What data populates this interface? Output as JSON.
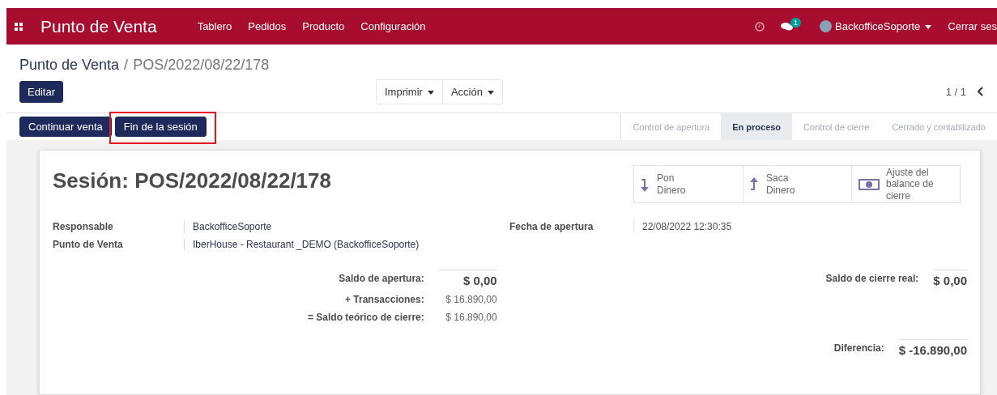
{
  "navbar": {
    "app_title": "Punto de Venta",
    "menu": [
      "Tablero",
      "Pedidos",
      "Producto",
      "Configuración"
    ],
    "messages_badge": "1",
    "user": "BackofficeSoporte",
    "logout": "Cerrar ses"
  },
  "breadcrumb": {
    "parent": "Punto de Venta",
    "separator": "/",
    "current": "POS/2022/08/22/178"
  },
  "toolbar": {
    "edit": "Editar",
    "dropdowns": [
      "Imprimir",
      "Acción"
    ],
    "pager": "1 / 1"
  },
  "actions": [
    {
      "label": "Continuar venta",
      "highlighted": false
    },
    {
      "label": "Fin de la sesión",
      "highlighted": true
    }
  ],
  "stages": [
    {
      "label": "Control de apertura",
      "selected": false
    },
    {
      "label": "En proceso",
      "selected": true
    },
    {
      "label": "Control de cierre",
      "selected": false
    },
    {
      "label": "Cerrado y contabilizado",
      "selected": false
    }
  ],
  "session": {
    "title": "Sesión: POS/2022/08/22/178",
    "buttons": [
      {
        "kind": "put",
        "label": "Pon Dinero"
      },
      {
        "kind": "take",
        "label": "Saca Dinero"
      },
      {
        "kind": "money",
        "label": "Ajuste del balance de cierre"
      }
    ],
    "fields_left": [
      {
        "label": "Responsable",
        "value": "BackofficeSoporte"
      },
      {
        "label": "Punto de Venta",
        "value": "IberHouse - Restaurant _DEMO (BackofficeSoporte)"
      }
    ],
    "fields_right": [
      {
        "label": "Fecha de apertura",
        "value": "22/08/2022 12:30:35"
      }
    ],
    "opening": [
      {
        "label": "Saldo de apertura:",
        "value": "$ 0,00",
        "kind": "total"
      },
      {
        "label": "+ Transacciones:",
        "value": "$ 16.890,00",
        "kind": "line"
      },
      {
        "label": "= Saldo teórico de cierre:",
        "value": "$ 16.890,00",
        "kind": "line"
      }
    ],
    "closing": {
      "label": "Saldo de cierre real:",
      "value": "$ 0,00"
    },
    "difference": {
      "label": "Diferencia:",
      "value": "$ -16.890,00"
    }
  }
}
